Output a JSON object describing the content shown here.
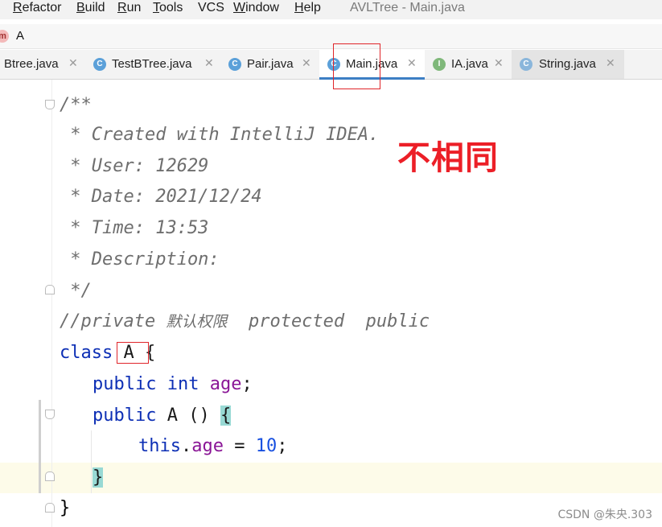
{
  "menubar": {
    "items": [
      {
        "underline": "R",
        "rest": "efactor"
      },
      {
        "underline": "B",
        "rest": "uild"
      },
      {
        "underline": "R",
        "rest": "un"
      },
      {
        "underline": "T",
        "rest": "ools"
      },
      {
        "underline": "",
        "rest": "VCS"
      },
      {
        "underline": "W",
        "rest": "indow"
      },
      {
        "underline": "H",
        "rest": "elp"
      }
    ],
    "window_title": "AVLTree - Main.java"
  },
  "navbar": {
    "icon_letter": "m",
    "class_name": "A"
  },
  "tabs": [
    {
      "label": "Btree.java",
      "icon": "",
      "active": false
    },
    {
      "label": "TestBTree.java",
      "icon": "C",
      "active": false
    },
    {
      "label": "Pair.java",
      "icon": "C",
      "active": false
    },
    {
      "label": "Main.java",
      "icon": "C",
      "active": true
    },
    {
      "label": "IA.java",
      "icon": "I",
      "active": false
    },
    {
      "label": "String.java",
      "icon": "C",
      "active": false
    }
  ],
  "code": {
    "line1": "/**",
    "line2": " * Created with IntelliJ IDEA.",
    "line3": " * User: 12629",
    "line4": " * Date: 2021/12/24",
    "line5": " * Time: 13:53",
    "line6": " * Description:",
    "line7": " */",
    "line8_a": "//private ",
    "line8_b": "默认权限",
    "line8_c": "  protected  public",
    "line9_kw": "class",
    "line9_name": "A",
    "line9_brace": "{",
    "line10_kw1": "public",
    "line10_kw2": "int",
    "line10_field": "age",
    "line10_semi": ";",
    "line11_kw": "public",
    "line11_name": "A",
    "line11_parens": "()",
    "line11_brace": "{",
    "line12_this": "this",
    "line12_dot": ".",
    "line12_field": "age",
    "line12_eq": " = ",
    "line12_num": "10",
    "line12_semi": ";",
    "line13": "}",
    "line14": "}"
  },
  "annotation": "不相同",
  "watermark": "CSDN @朱央.303",
  "colors": {
    "keyword": "#0d2fb5",
    "field": "#8a1596",
    "number": "#1850e0",
    "comment": "#6e6e6e",
    "annotation_red": "#ec1f27",
    "active_tab_underline": "#3d7fc4"
  }
}
